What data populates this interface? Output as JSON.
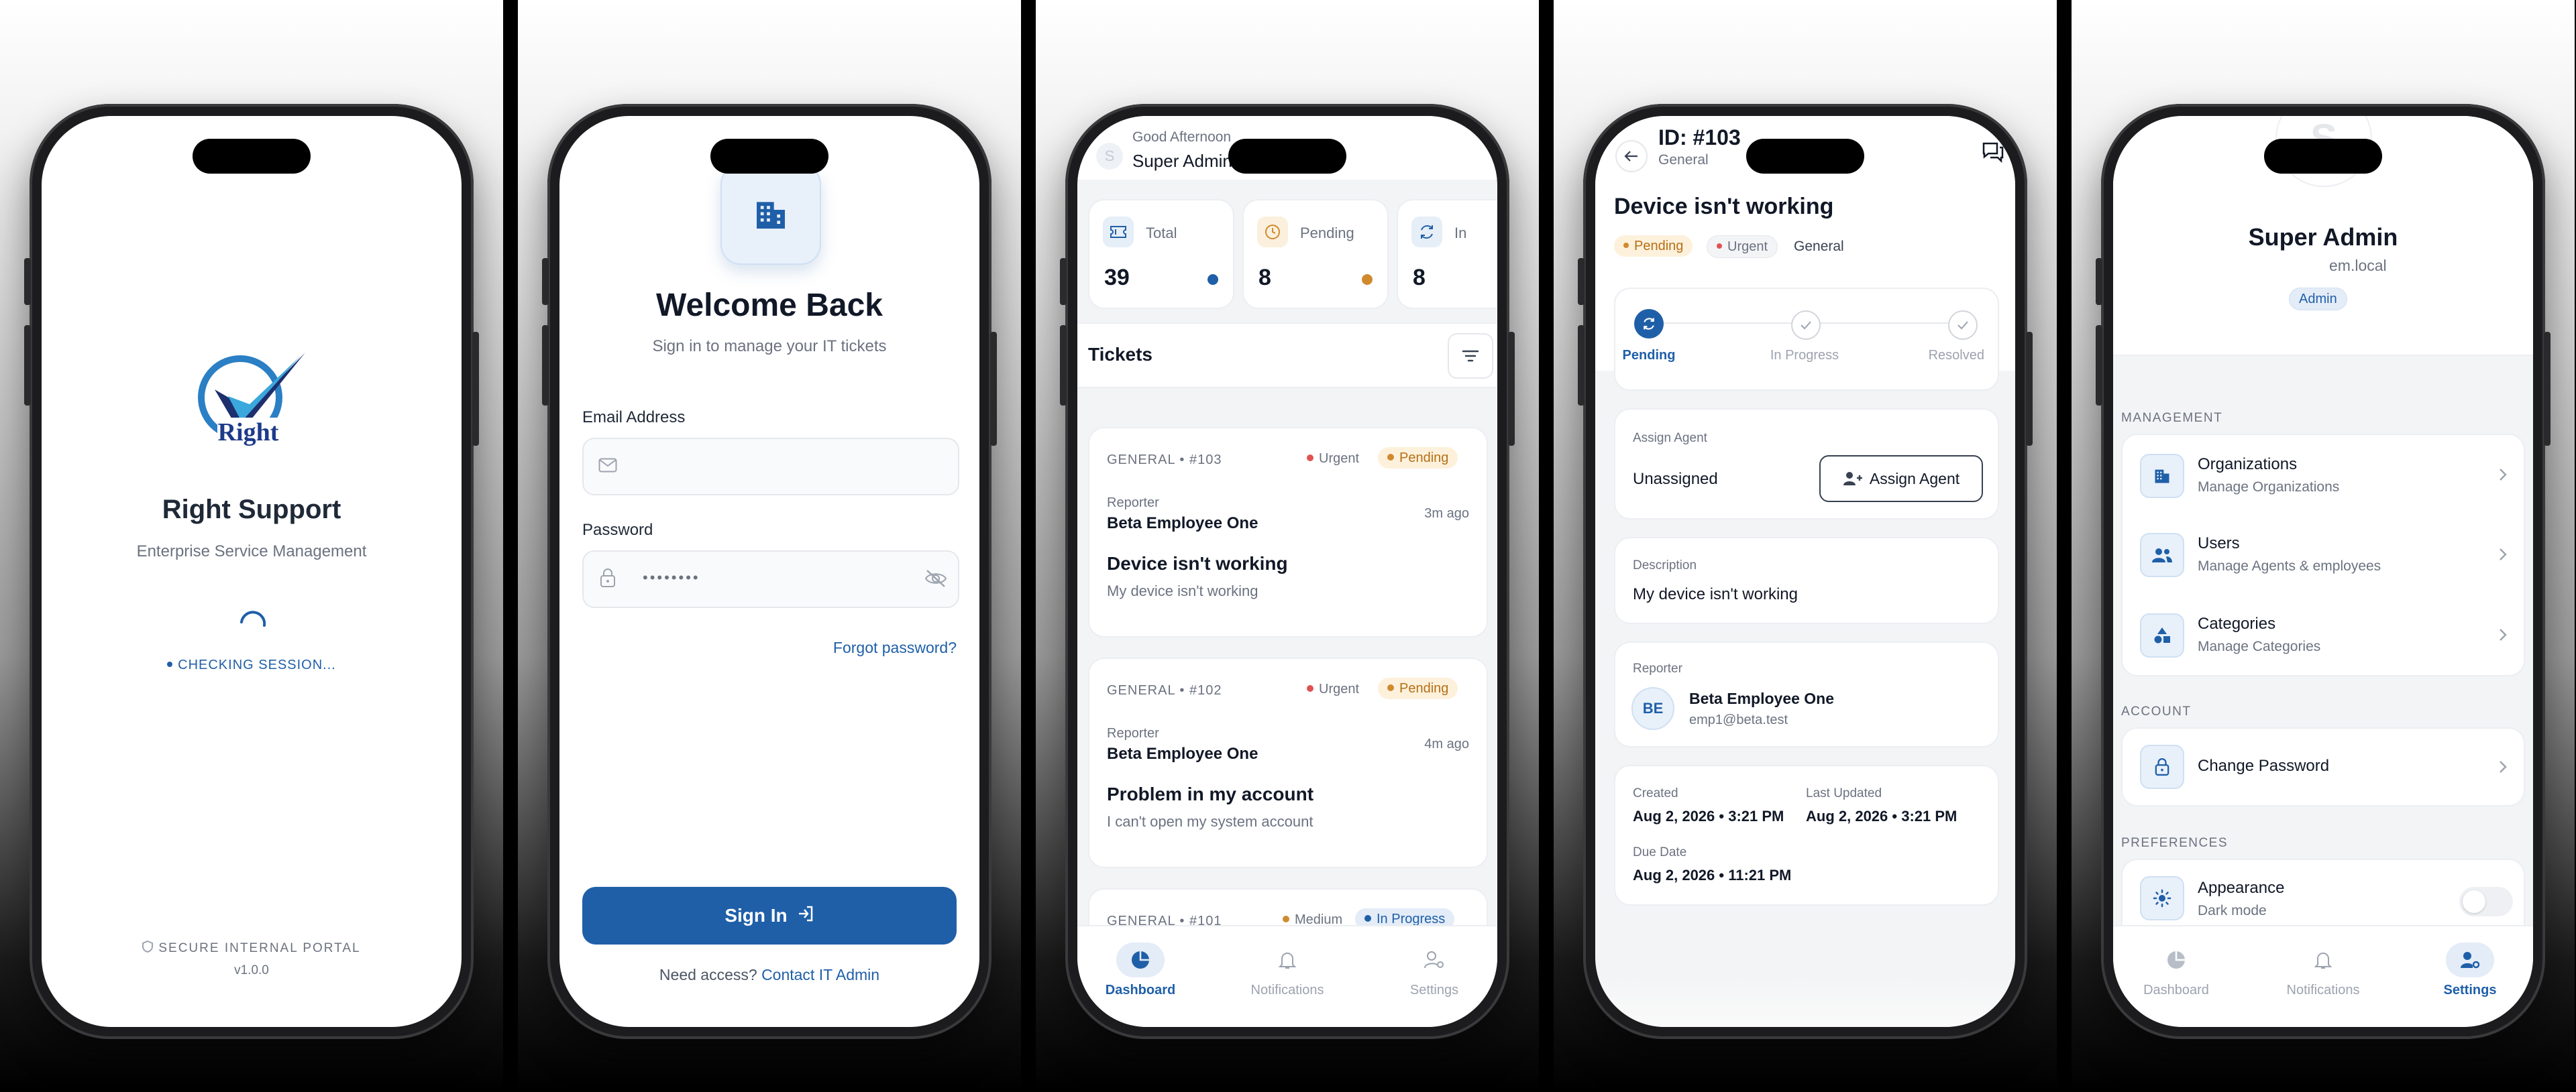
{
  "screen1": {
    "app_name": "Right Support",
    "tagline": "Enterprise Service Management",
    "logo_text": "Right",
    "status": "CHECKING SESSION...",
    "footer": "SECURE INTERNAL PORTAL",
    "version": "v1.0.0"
  },
  "screen2": {
    "title": "Welcome Back",
    "subtitle": "Sign in to manage your IT tickets",
    "email_label": "Email Address",
    "email_value": "",
    "password_label": "Password",
    "password_value": "••••••••",
    "forgot": "Forgot password?",
    "signin": "Sign In",
    "need_access": "Need access?",
    "contact": "Contact IT Admin"
  },
  "screen3": {
    "greeting": "Good Afternoon",
    "user": "Super Admin",
    "stats": [
      {
        "label": "Total",
        "value": "39",
        "color": "#1f5fa8"
      },
      {
        "label": "Pending",
        "value": "8",
        "color": "#d08a2e"
      },
      {
        "label": "In",
        "value": "8",
        "color": "#1f5fa8"
      }
    ],
    "tickets_title": "Tickets",
    "reporter_label": "Reporter",
    "tickets": [
      {
        "meta": "GENERAL • #103",
        "priority": "Urgent",
        "status": "Pending",
        "reporter": "Beta Employee One",
        "time": "3m ago",
        "title": "Device isn't working",
        "desc": "My device isn't working"
      },
      {
        "meta": "GENERAL • #102",
        "priority": "Urgent",
        "status": "Pending",
        "reporter": "Beta Employee One",
        "time": "4m ago",
        "title": "Problem in my account",
        "desc": "I can't open my system account"
      },
      {
        "meta": "GENERAL • #101",
        "priority": "Medium",
        "status": "In Progress"
      }
    ],
    "nav": {
      "dashboard": "Dashboard",
      "notifications": "Notifications",
      "settings": "Settings"
    }
  },
  "screen4": {
    "id": "ID: #103",
    "category": "General",
    "title": "Device isn't working",
    "status": "Pending",
    "priority": "Urgent",
    "tag": "General",
    "steps": [
      "Pending",
      "In Progress",
      "Resolved"
    ],
    "assign_label": "Assign Agent",
    "assign_value": "Unassigned",
    "assign_button": "Assign Agent",
    "desc_label": "Description",
    "desc_value": "My device isn't working",
    "reporter_label": "Reporter",
    "reporter_initials": "BE",
    "reporter_name": "Beta Employee One",
    "reporter_email": "emp1@beta.test",
    "created_label": "Created",
    "created_value": "Aug 2, 2026 • 3:21 PM",
    "updated_label": "Last Updated",
    "updated_value": "Aug 2, 2026 • 3:21 PM",
    "due_label": "Due Date",
    "due_value": "Aug 2, 2026 • 11:21 PM"
  },
  "screen5": {
    "avatar": "S",
    "name": "Super Admin",
    "email": "em.local",
    "role": "Admin",
    "sections": {
      "management": "MANAGEMENT",
      "account": "ACCOUNT",
      "preferences": "PREFERENCES"
    },
    "items": [
      {
        "title": "Organizations",
        "sub": "Manage Organizations"
      },
      {
        "title": "Users",
        "sub": "Manage Agents & employees"
      },
      {
        "title": "Categories",
        "sub": "Manage Categories"
      }
    ],
    "change_password": "Change Password",
    "appearance": "Appearance",
    "appearance_sub": "Dark mode",
    "nav": {
      "dashboard": "Dashboard",
      "notifications": "Notifications",
      "settings": "Settings"
    }
  },
  "colors": {
    "primary": "#1f5fa8",
    "urgent": "#e05252",
    "pending": "#d08a2e",
    "bg": "#f3f4f6"
  }
}
